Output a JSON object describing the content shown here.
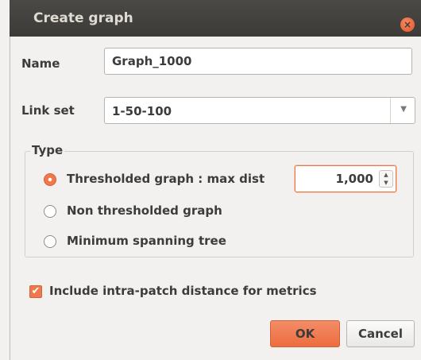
{
  "window": {
    "title": "Create graph",
    "close_icon": "close-icon",
    "close_glyph": "×"
  },
  "form": {
    "name_label": "Name",
    "name_value": "Graph_1000",
    "linkset_label": "Link set",
    "linkset_value": "1-50-100",
    "linkset_arrow_icon": "chevron-down-icon"
  },
  "type_group": {
    "title": "Type",
    "options": [
      {
        "label": "Thresholded graph : max dist",
        "checked": true
      },
      {
        "label": "Non thresholded graph",
        "checked": false
      },
      {
        "label": "Minimum spanning tree",
        "checked": false
      }
    ],
    "max_dist_value": "1,000"
  },
  "intra_patch": {
    "label": "Include intra-patch distance for metrics",
    "checked": true,
    "check_glyph": "✔"
  },
  "buttons": {
    "ok": "OK",
    "cancel": "Cancel"
  },
  "colors": {
    "accent": "#f0784c",
    "titlebar": "#3c3b37",
    "background": "#f2f1f0"
  }
}
